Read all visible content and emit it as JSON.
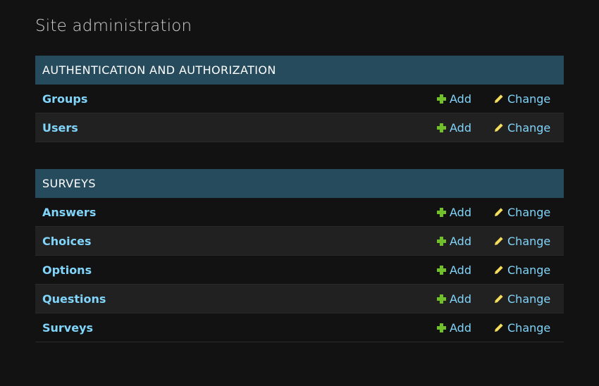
{
  "page_title": "Site administration",
  "colors": {
    "background": "#121212",
    "caption_bg": "#264b5d",
    "link": "#81d4fa",
    "add_icon": "#70bf2b",
    "change_icon": "#f5dd5d"
  },
  "modules": [
    {
      "caption": "AUTHENTICATION AND AUTHORIZATION",
      "models": [
        {
          "name": "Groups",
          "add": "Add",
          "change": "Change"
        },
        {
          "name": "Users",
          "add": "Add",
          "change": "Change"
        }
      ]
    },
    {
      "caption": "SURVEYS",
      "models": [
        {
          "name": "Answers",
          "add": "Add",
          "change": "Change"
        },
        {
          "name": "Choices",
          "add": "Add",
          "change": "Change"
        },
        {
          "name": "Options",
          "add": "Add",
          "change": "Change"
        },
        {
          "name": "Questions",
          "add": "Add",
          "change": "Change"
        },
        {
          "name": "Surveys",
          "add": "Add",
          "change": "Change"
        }
      ]
    }
  ],
  "icons": {
    "add": "plus-icon",
    "change": "pencil-icon"
  }
}
